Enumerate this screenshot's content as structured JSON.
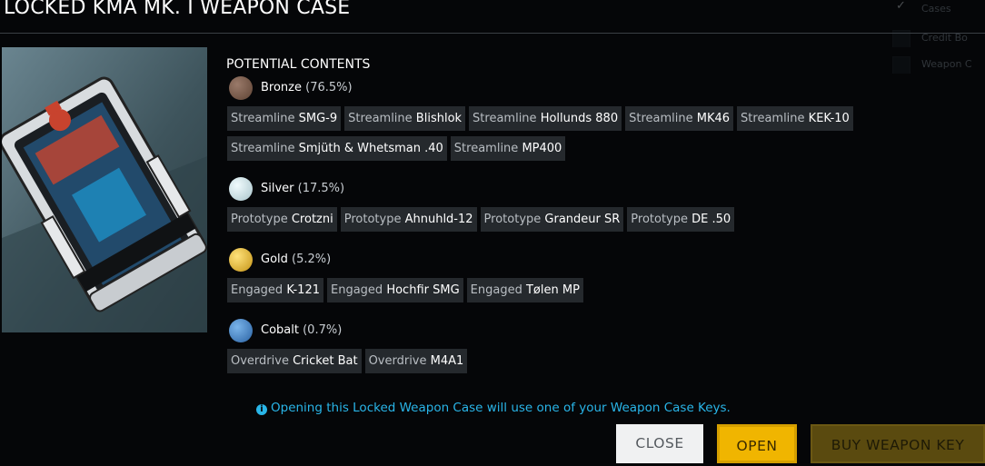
{
  "title": "LOCKED KMA MK. I WEAPON CASE",
  "background_filters": [
    {
      "label": "Cases",
      "checked": true
    },
    {
      "label": "Credit Bo",
      "checked": false
    },
    {
      "label": "Weapon C",
      "checked": false
    }
  ],
  "contents_heading": "POTENTIAL CONTENTS",
  "tiers": [
    {
      "name": "Bronze",
      "percent": "(76.5%)",
      "color": "#7a5a4a",
      "rows": [
        [
          {
            "prefix": "Streamline",
            "name": "SMG-9"
          },
          {
            "prefix": "Streamline",
            "name": "Blishlok"
          },
          {
            "prefix": "Streamline",
            "name": "Hollunds 880"
          },
          {
            "prefix": "Streamline",
            "name": "MK46"
          },
          {
            "prefix": "Streamline",
            "name": "KEK-10"
          }
        ],
        [
          {
            "prefix": "Streamline",
            "name": "Smjüth & Whetsman .40"
          },
          {
            "prefix": "Streamline",
            "name": "MP400"
          }
        ]
      ]
    },
    {
      "name": "Silver",
      "percent": "(17.5%)",
      "color": "#c9dfe5",
      "rows": [
        [
          {
            "prefix": "Prototype",
            "name": "Crotzni"
          },
          {
            "prefix": "Prototype",
            "name": "Ahnuhld-12"
          },
          {
            "prefix": "Prototype",
            "name": "Grandeur SR"
          },
          {
            "prefix": "Prototype",
            "name": "DE .50"
          }
        ]
      ]
    },
    {
      "name": "Gold",
      "percent": "(5.2%)",
      "color": "#e2b52c",
      "rows": [
        [
          {
            "prefix": "Engaged",
            "name": "K-121"
          },
          {
            "prefix": "Engaged",
            "name": "Hochfir SMG"
          },
          {
            "prefix": "Engaged",
            "name": "Tølen MP"
          }
        ]
      ]
    },
    {
      "name": "Cobalt",
      "percent": "(0.7%)",
      "color": "#3d84c9",
      "rows": [
        [
          {
            "prefix": "Overdrive",
            "name": "Cricket Bat"
          },
          {
            "prefix": "Overdrive",
            "name": "M4A1"
          }
        ]
      ]
    }
  ],
  "notice": {
    "icon": "info-icon",
    "text": "Opening this Locked Weapon Case will use one of your Weapon Case Keys."
  },
  "buttons": {
    "close": "CLOSE",
    "open": "OPEN",
    "buy_key": "BUY WEAPON KEY"
  },
  "colors": {
    "accent_blue": "#29b5e8",
    "open_yellow": "#f0b500",
    "buy_dark_gold": "#5a4a0f",
    "chip_bg": "#25292d"
  }
}
